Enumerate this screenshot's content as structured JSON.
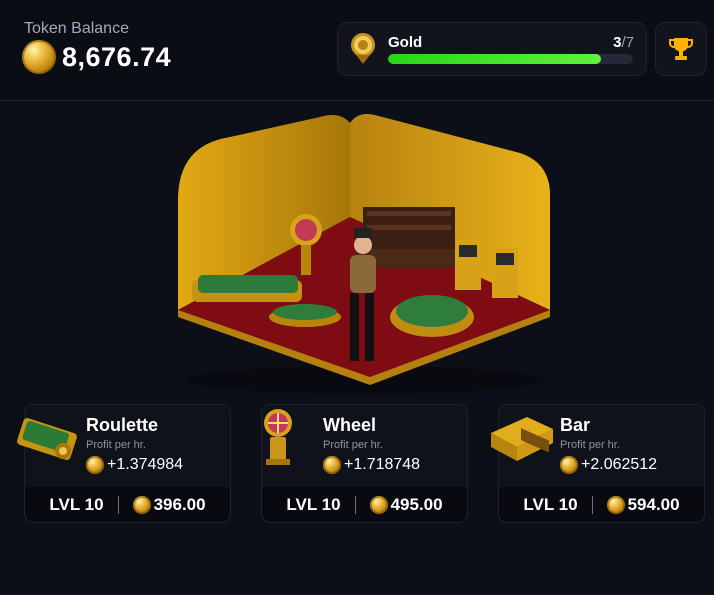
{
  "balance": {
    "label": "Token Balance",
    "value": "8,676.74"
  },
  "rank": {
    "name": "Gold",
    "current": "3",
    "total": "/7",
    "progress": 0.87
  },
  "trophy": {
    "icon": "trophy-icon"
  },
  "colors": {
    "accent_green": "#3ee22a",
    "gold": "#f0c24a",
    "background": "#0d0f18"
  },
  "upgrades": [
    {
      "title": "Roulette",
      "profit_label": "Profit per hr.",
      "profit": "+1.374984",
      "level": "LVL 10",
      "cost": "396.00"
    },
    {
      "title": "Wheel",
      "profit_label": "Profit per hr.",
      "profit": "+1.718748",
      "level": "LVL 10",
      "cost": "495.00"
    },
    {
      "title": "Bar",
      "profit_label": "Profit per hr.",
      "profit": "+2.062512",
      "level": "LVL 10",
      "cost": "594.00"
    }
  ]
}
